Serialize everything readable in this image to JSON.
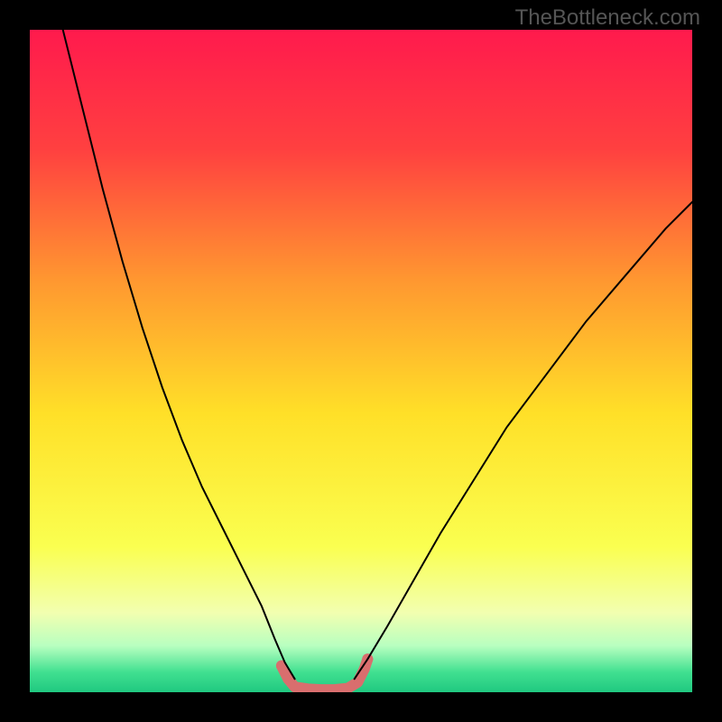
{
  "watermark": "TheBottleneck.com",
  "chart_data": {
    "type": "line",
    "title": "",
    "xlabel": "",
    "ylabel": "",
    "xlim": [
      0,
      100
    ],
    "ylim": [
      0,
      100
    ],
    "background": {
      "type": "vertical-gradient",
      "stops": [
        {
          "pos": 0.0,
          "color": "#ff1a4d"
        },
        {
          "pos": 0.18,
          "color": "#ff4040"
        },
        {
          "pos": 0.38,
          "color": "#ff9830"
        },
        {
          "pos": 0.58,
          "color": "#ffe028"
        },
        {
          "pos": 0.78,
          "color": "#faff50"
        },
        {
          "pos": 0.88,
          "color": "#f2ffb0"
        },
        {
          "pos": 0.93,
          "color": "#b8ffc0"
        },
        {
          "pos": 0.97,
          "color": "#40e090"
        },
        {
          "pos": 1.0,
          "color": "#20c880"
        }
      ]
    },
    "series": [
      {
        "name": "left-curve",
        "color": "#000000",
        "width": 2,
        "points": [
          {
            "x": 5.0,
            "y": 100.0
          },
          {
            "x": 8.0,
            "y": 88.0
          },
          {
            "x": 11.0,
            "y": 76.0
          },
          {
            "x": 14.0,
            "y": 65.0
          },
          {
            "x": 17.0,
            "y": 55.0
          },
          {
            "x": 20.0,
            "y": 46.0
          },
          {
            "x": 23.0,
            "y": 38.0
          },
          {
            "x": 26.0,
            "y": 31.0
          },
          {
            "x": 29.0,
            "y": 25.0
          },
          {
            "x": 32.0,
            "y": 19.0
          },
          {
            "x": 35.0,
            "y": 13.0
          },
          {
            "x": 37.0,
            "y": 8.0
          },
          {
            "x": 38.5,
            "y": 4.5
          },
          {
            "x": 40.0,
            "y": 2.0
          }
        ]
      },
      {
        "name": "right-curve",
        "color": "#000000",
        "width": 2,
        "points": [
          {
            "x": 49.0,
            "y": 2.0
          },
          {
            "x": 51.0,
            "y": 5.0
          },
          {
            "x": 54.0,
            "y": 10.0
          },
          {
            "x": 58.0,
            "y": 17.0
          },
          {
            "x": 62.0,
            "y": 24.0
          },
          {
            "x": 67.0,
            "y": 32.0
          },
          {
            "x": 72.0,
            "y": 40.0
          },
          {
            "x": 78.0,
            "y": 48.0
          },
          {
            "x": 84.0,
            "y": 56.0
          },
          {
            "x": 90.0,
            "y": 63.0
          },
          {
            "x": 96.0,
            "y": 70.0
          },
          {
            "x": 100.0,
            "y": 74.0
          }
        ]
      },
      {
        "name": "highlight-band",
        "color": "#d96e6e",
        "width": 12,
        "dots": true,
        "points": [
          {
            "x": 38.0,
            "y": 4.0
          },
          {
            "x": 39.0,
            "y": 2.0
          },
          {
            "x": 40.0,
            "y": 0.8
          },
          {
            "x": 42.0,
            "y": 0.5
          },
          {
            "x": 44.0,
            "y": 0.4
          },
          {
            "x": 46.0,
            "y": 0.4
          },
          {
            "x": 48.0,
            "y": 0.6
          },
          {
            "x": 49.5,
            "y": 1.5
          },
          {
            "x": 50.5,
            "y": 3.5
          },
          {
            "x": 51.0,
            "y": 5.0
          }
        ]
      }
    ]
  }
}
